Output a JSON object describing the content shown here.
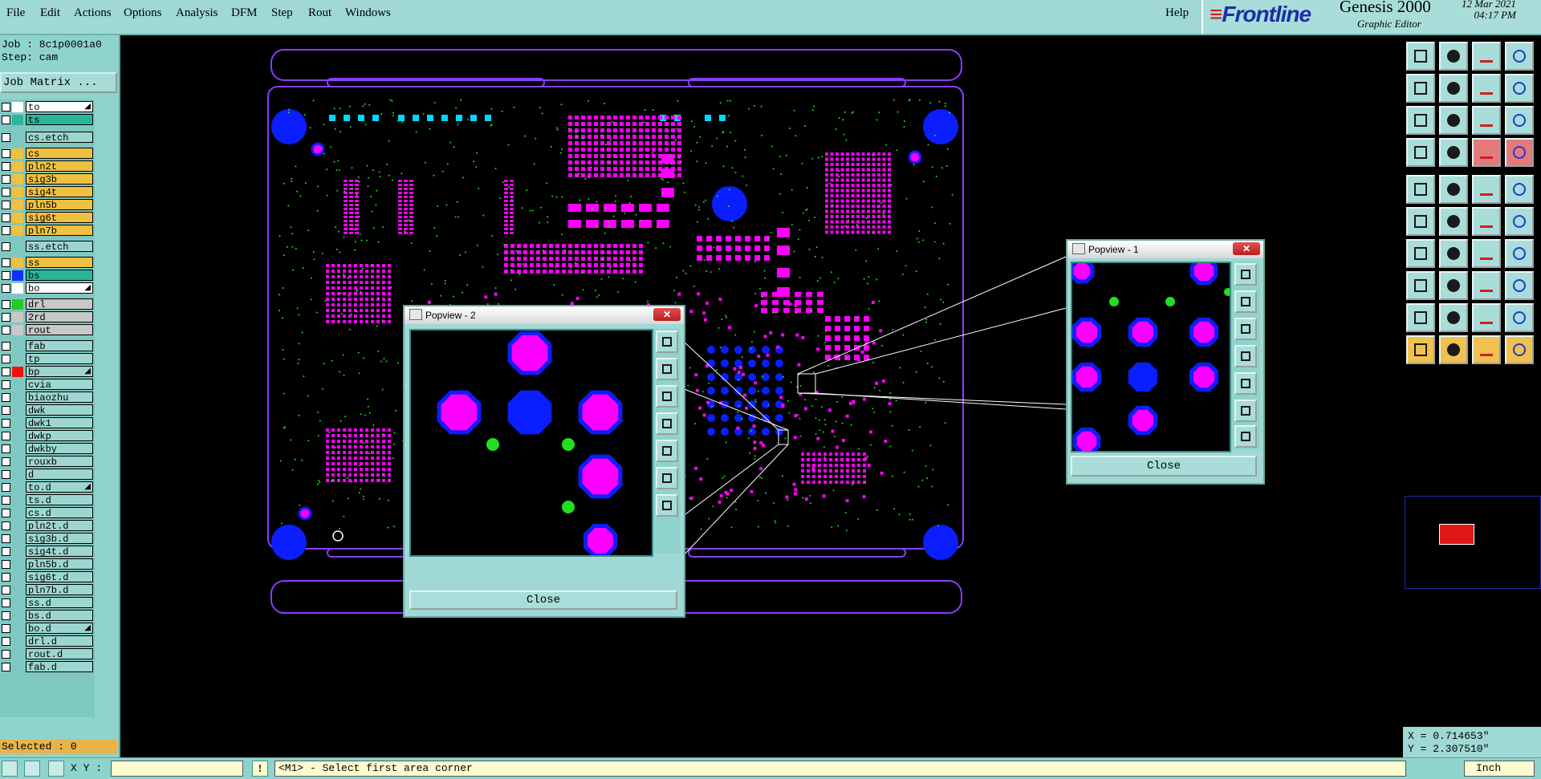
{
  "menu": {
    "items": [
      "File",
      "Edit",
      "Actions",
      "Options",
      "Analysis",
      "DFM",
      "Step",
      "Rout",
      "Windows"
    ],
    "help": "Help"
  },
  "brand": {
    "logo": "Frontline",
    "product": "Genesis 2000",
    "subtitle": "Graphic Editor",
    "date": "12 Mar 2021",
    "time": "04:17 PM"
  },
  "job": {
    "job_line": "Job : 8c1p0001a0",
    "step_line": "Step: cam",
    "matrix_button": "Job Matrix ..."
  },
  "layers": [
    {
      "name": "to",
      "color": "#ffffff",
      "bg": "#ffffff",
      "aff": true
    },
    {
      "name": "ts",
      "color": "#2bb69b",
      "bg": "#2bb69b"
    },
    {
      "name": "cs.etch",
      "color": "#9dd6d0",
      "bg": "#9dd6d0"
    },
    {
      "name": "cs",
      "color": "#f0c040",
      "bg": "#f0c040"
    },
    {
      "name": "pln2t",
      "color": "#f0c040",
      "bg": "#f0c040"
    },
    {
      "name": "sig3b",
      "color": "#f0c040",
      "bg": "#f0c040"
    },
    {
      "name": "sig4t",
      "color": "#f0c040",
      "bg": "#f0c040"
    },
    {
      "name": "pln5b",
      "color": "#f0c040",
      "bg": "#f0c040"
    },
    {
      "name": "sig6t",
      "color": "#f0c040",
      "bg": "#f0c040"
    },
    {
      "name": "pln7b",
      "color": "#f0c040",
      "bg": "#f0c040"
    },
    {
      "name": "ss.etch",
      "color": "#9dd6d0",
      "bg": "#9dd6d0"
    },
    {
      "name": "ss",
      "color": "#f0c040",
      "bg": "#f0c040"
    },
    {
      "name": "bs",
      "color": "#1030ff",
      "bg": "#2bb69b"
    },
    {
      "name": "bo",
      "color": "#ffffff",
      "bg": "#ffffff",
      "aff": true
    },
    {
      "name": "drl",
      "color": "#22cc22",
      "bg": "#c8c8c8"
    },
    {
      "name": "2rd",
      "color": "#c8c8c8",
      "bg": "#c8c8c8"
    },
    {
      "name": "rout",
      "color": "#c8c8c8",
      "bg": "#c8c8c8"
    },
    {
      "name": "fab",
      "color": "#9dd6d0",
      "bg": "#9dd6d0"
    },
    {
      "name": "tp",
      "color": "#9dd6d0",
      "bg": "#9dd6d0"
    },
    {
      "name": "bp",
      "color": "#ee1111",
      "bg": "#9dd6d0",
      "aff": true
    },
    {
      "name": "cvia",
      "color": "#9dd6d0",
      "bg": "#9dd6d0"
    },
    {
      "name": "biaozhu",
      "color": "#9dd6d0",
      "bg": "#9dd6d0"
    },
    {
      "name": "dwk",
      "color": "#9dd6d0",
      "bg": "#9dd6d0"
    },
    {
      "name": "dwk1",
      "color": "#9dd6d0",
      "bg": "#9dd6d0"
    },
    {
      "name": "dwkp",
      "color": "#9dd6d0",
      "bg": "#9dd6d0"
    },
    {
      "name": "dwkby",
      "color": "#9dd6d0",
      "bg": "#9dd6d0"
    },
    {
      "name": "rouxb",
      "color": "#9dd6d0",
      "bg": "#9dd6d0"
    },
    {
      "name": "d",
      "color": "#9dd6d0",
      "bg": "#9dd6d0"
    },
    {
      "name": "to.d",
      "color": "#9dd6d0",
      "bg": "#9dd6d0",
      "aff": true
    },
    {
      "name": "ts.d",
      "color": "#9dd6d0",
      "bg": "#9dd6d0"
    },
    {
      "name": "cs.d",
      "color": "#9dd6d0",
      "bg": "#9dd6d0"
    },
    {
      "name": "pln2t.d",
      "color": "#9dd6d0",
      "bg": "#9dd6d0"
    },
    {
      "name": "sig3b.d",
      "color": "#9dd6d0",
      "bg": "#9dd6d0"
    },
    {
      "name": "sig4t.d",
      "color": "#9dd6d0",
      "bg": "#9dd6d0"
    },
    {
      "name": "pln5b.d",
      "color": "#9dd6d0",
      "bg": "#9dd6d0"
    },
    {
      "name": "sig6t.d",
      "color": "#9dd6d0",
      "bg": "#9dd6d0"
    },
    {
      "name": "pln7b.d",
      "color": "#9dd6d0",
      "bg": "#9dd6d0"
    },
    {
      "name": "ss.d",
      "color": "#9dd6d0",
      "bg": "#9dd6d0"
    },
    {
      "name": "bs.d",
      "color": "#9dd6d0",
      "bg": "#9dd6d0"
    },
    {
      "name": "bo.d",
      "color": "#9dd6d0",
      "bg": "#9dd6d0",
      "aff": true
    },
    {
      "name": "drl.d",
      "color": "#9dd6d0",
      "bg": "#9dd6d0"
    },
    {
      "name": "rout.d",
      "color": "#9dd6d0",
      "bg": "#9dd6d0"
    },
    {
      "name": "fab.d",
      "color": "#9dd6d0",
      "bg": "#9dd6d0"
    }
  ],
  "selected_text": "Selected : 0",
  "popview2": {
    "title": "Popview - 2",
    "close": "Close"
  },
  "popview1": {
    "title": "Popview - 1",
    "close": "Close"
  },
  "coords": {
    "x": "X = 0.714653\"",
    "y": "Y = 2.307510\""
  },
  "status": {
    "xy_label": "X Y :",
    "xy_value": "",
    "prompt": "<M1> - Select first area corner",
    "units": "Inch"
  },
  "colors": {
    "pad_magenta": "#ff00ff",
    "pad_blue": "#0a1eff",
    "drill_green": "#22dd22",
    "outline_violet": "#8a3cff",
    "panel_cyan": "#9fd8d4"
  },
  "toolbar_icons": [
    "snapshot-icon",
    "save-view-icon",
    "home-icon",
    "flip-icon",
    "pan-left-icon",
    "pan-right-icon",
    "mirror-icon",
    "redo-icon",
    "zoom-fit-icon",
    "zoom-center-icon",
    "scale-1-2-icon",
    "help-icon",
    "measure-icon",
    "probe-icon",
    "net-trace-icon",
    "layer-compare-icon",
    "add-pad-icon",
    "draw-line-icon",
    "ruler-icon",
    "spot-icon",
    "node-edit-icon",
    "snap-center-icon",
    "snap-point-icon",
    "select-box-icon",
    "line-angle-icon",
    "slash-icon",
    "rotate-icon",
    "frontline-ff-icon",
    "add-surface-icon",
    "add-line-icon",
    "resize-icon",
    "merge-icon",
    "triangle-a-icon",
    "triangle-b-icon",
    "triangle-c-icon",
    "triangle-d-icon",
    "pointer-icon",
    "pointer-select-icon",
    "pointer-move-icon",
    "pointer-multi-icon"
  ]
}
